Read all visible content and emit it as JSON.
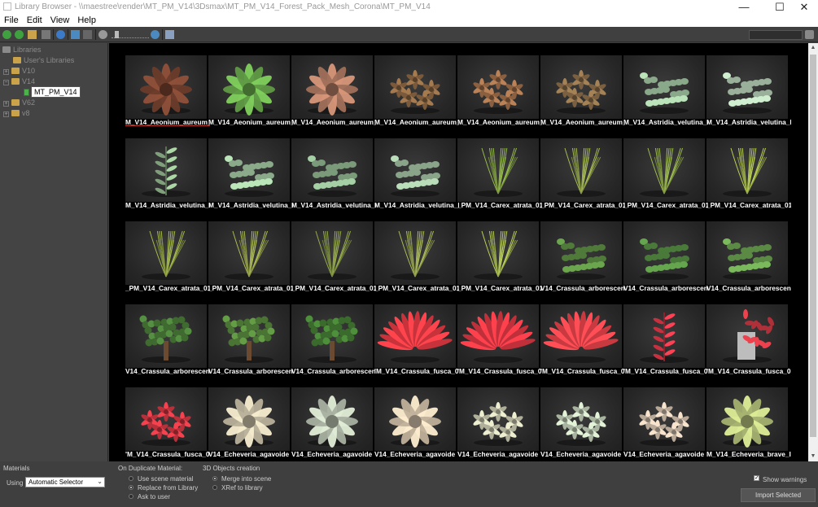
{
  "window": {
    "title": "Library Browser - \\\\maestree\\render\\MT_PM_V14\\3Dsmax\\MT_PM_V14_Forest_Pack_Mesh_Corona\\MT_PM_V14",
    "controls": [
      "—",
      "☐",
      "✕"
    ]
  },
  "menu": [
    "File",
    "Edit",
    "View",
    "Help"
  ],
  "toolbar": {
    "icons": [
      "back-icon",
      "forward-icon",
      "open-folder-icon",
      "square-icon",
      "refresh-icon",
      "tree-icon",
      "zoom-out-icon",
      "zoom-slider",
      "zoom-in-icon",
      "help-icon",
      "filter-icon"
    ],
    "zoom_level": 0.12
  },
  "sidebar": {
    "items": [
      {
        "label": "Libraries",
        "level": 0
      },
      {
        "label": "User's Libraries",
        "level": 1
      },
      {
        "label": "V10",
        "level": 1
      },
      {
        "label": "V14",
        "level": 1
      },
      {
        "label": "MT_PM_V14",
        "level": 2,
        "selected": true
      },
      {
        "label": "V62",
        "level": 1
      },
      {
        "label": "v8",
        "level": 1
      }
    ]
  },
  "grid": {
    "items": [
      {
        "label": "M_V14_Aeonium_aureum_",
        "plant": "rosette",
        "color": "#6b3b2a",
        "selected": true
      },
      {
        "label": "M_V14_Aeonium_aureum_I",
        "plant": "rosette",
        "color": "#5f9a45"
      },
      {
        "label": "M_V14_Aeonium_aureum_I",
        "plant": "rosette",
        "color": "#a0705a"
      },
      {
        "label": "M_V14_Aeonium_aureum_I",
        "plant": "cluster",
        "color": "#7a5a3a"
      },
      {
        "label": "M_V14_Aeonium_aureum_I",
        "plant": "cluster",
        "color": "#8a6040"
      },
      {
        "label": "M_V14_Aeonium_aureum_I",
        "plant": "cluster",
        "color": "#7a6040"
      },
      {
        "label": "M_V14_Astridia_velutina_I",
        "plant": "shrub",
        "color": "#8aa88a"
      },
      {
        "label": "M_V14_Astridia_velutina_I",
        "plant": "shrub",
        "color": "#9ab09a"
      },
      {
        "label": "M_V14_Astridia_velutina_I",
        "plant": "tall",
        "color": "#7fa07a"
      },
      {
        "label": "M_V14_Astridia_velutina_I",
        "plant": "shrub",
        "color": "#8aaa8a"
      },
      {
        "label": "M_V14_Astridia_velutina_I",
        "plant": "shrub",
        "color": "#7a9a7a"
      },
      {
        "label": "M_V14_Astridia_velutina_I",
        "plant": "shrub",
        "color": "#8aa48a"
      },
      {
        "label": "_PM_V14_Carex_atrata_01",
        "plant": "grass",
        "color": "#6f8a3a"
      },
      {
        "label": "_PM_V14_Carex_atrata_01",
        "plant": "grass",
        "color": "#7a8a40"
      },
      {
        "label": "_PM_V14_Carex_atrata_01",
        "plant": "grass",
        "color": "#748a3c"
      },
      {
        "label": "_PM_V14_Carex_atrata_01",
        "plant": "grass",
        "color": "#8a9a40"
      },
      {
        "label": "_PM_V14_Carex_atrata_01",
        "plant": "grass",
        "color": "#7a8a3a"
      },
      {
        "label": "_PM_V14_Carex_atrata_01",
        "plant": "grass",
        "color": "#808a40"
      },
      {
        "label": "_PM_V14_Carex_atrata_01",
        "plant": "grass",
        "color": "#6f7f3a"
      },
      {
        "label": "_PM_V14_Carex_atrata_01",
        "plant": "grass",
        "color": "#7f8a44"
      },
      {
        "label": "_PM_V14_Carex_atrata_01",
        "plant": "grass",
        "color": "#8a9a44"
      },
      {
        "label": "V14_Crassula_arborescen",
        "plant": "bush",
        "color": "#4f7a3a"
      },
      {
        "label": "V14_Crassula_arborescen",
        "plant": "bush",
        "color": "#4a7a3a"
      },
      {
        "label": "V14_Crassula_arborescen",
        "plant": "bush",
        "color": "#5a8a44"
      },
      {
        "label": "V14_Crassula_arborescen",
        "plant": "tree",
        "color": "#3f6a30"
      },
      {
        "label": "V14_Crassula_arborescen",
        "plant": "tree",
        "color": "#4a7434"
      },
      {
        "label": "V14_Crassula_arborescen",
        "plant": "tree",
        "color": "#3a6a2c"
      },
      {
        "label": "'M_V14_Crassula_fusca_0",
        "plant": "spiky",
        "color": "#c8323a"
      },
      {
        "label": "'M_V14_Crassula_fusca_0",
        "plant": "spiky",
        "color": "#c0303a"
      },
      {
        "label": "'M_V14_Crassula_fusca_0",
        "plant": "spiky",
        "color": "#c83a40"
      },
      {
        "label": "'M_V14_Crassula_fusca_0",
        "plant": "tall",
        "color": "#c83040"
      },
      {
        "label": "'M_V14_Crassula_fusca_0",
        "plant": "pot",
        "color": "#b0303a"
      },
      {
        "label": "'M_V14_Crassula_fusca_0",
        "plant": "cluster",
        "color": "#b8303a"
      },
      {
        "label": "V14_Echeveria_agavoide",
        "plant": "rosette",
        "color": "#b8b09a"
      },
      {
        "label": "V14_Echeveria_agavoide",
        "plant": "rosette",
        "color": "#a8b0a0"
      },
      {
        "label": "V14_Echeveria_agavoide",
        "plant": "rosette",
        "color": "#c0b09a"
      },
      {
        "label": "V14_Echeveria_agavoide",
        "plant": "cluster",
        "color": "#b0b09a"
      },
      {
        "label": "V14_Echeveria_agavoide",
        "plant": "cluster",
        "color": "#a8b4a0"
      },
      {
        "label": "V14_Echeveria_agavoide",
        "plant": "cluster",
        "color": "#b8a898"
      },
      {
        "label": "M_V14_Echeveria_brave_I",
        "plant": "rosette",
        "color": "#a4b070"
      }
    ]
  },
  "bottom": {
    "materials_label": "Materials",
    "using_label": "Using",
    "using_value": "Automatic Selector",
    "duplicate_label": "On Duplicate Material:",
    "duplicate_options": [
      "Use scene material",
      "Replace from Library",
      "Ask to user"
    ],
    "duplicate_selected": 1,
    "objects_label": "3D Objects creation",
    "objects_options": [
      "Merge into scene",
      "XRef to library"
    ],
    "objects_selected": 0,
    "show_warnings": "Show warnings",
    "show_warnings_checked": true,
    "import_button": "Import Selected"
  }
}
